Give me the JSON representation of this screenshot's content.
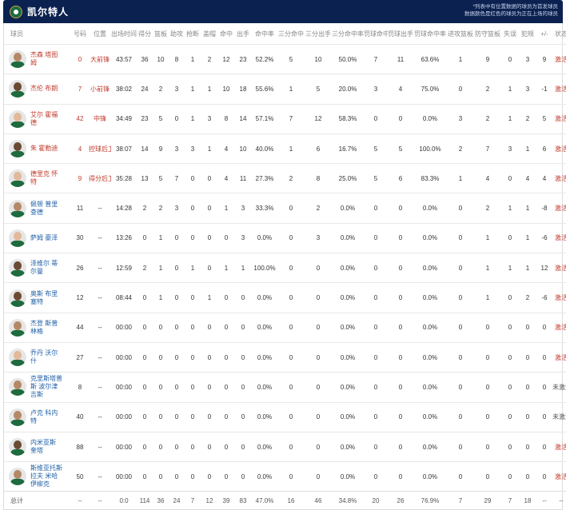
{
  "team": {
    "name": "凯尔特人",
    "note_line1": "*列表中有位置数据的球员为首发球员",
    "note_line2": "数据颜色是红色的球员为正在上场的球员"
  },
  "columns": [
    "球员",
    "号码",
    "位置",
    "出场时间",
    "得分",
    "篮板",
    "助攻",
    "抢断",
    "盖帽",
    "命中",
    "出手",
    "命中率",
    "三分命中",
    "三分出手",
    "三分命中率",
    "罚球命中",
    "罚球出手",
    "罚球命中率",
    "进攻篮板",
    "防守篮板",
    "失误",
    "犯规",
    "+/-",
    "状态"
  ],
  "players": [
    {
      "name": "杰森 塔图姆",
      "number": "0",
      "position": "大前锋",
      "min": "43:57",
      "pts": "36",
      "reb": "10",
      "ast": "8",
      "stl": "1",
      "blk": "2",
      "fgm": "12",
      "fga": "23",
      "fgp": "52.2%",
      "tpm": "5",
      "tpa": "10",
      "tpp": "50.0%",
      "ftm": "7",
      "fta": "11",
      "ftp": "63.6%",
      "oreb": "1",
      "dreb": "9",
      "tov": "0",
      "pf": "3",
      "pm": "9",
      "status": "激活",
      "starter": true
    },
    {
      "name": "杰伦 布朗",
      "number": "7",
      "position": "小前锋",
      "min": "38:02",
      "pts": "24",
      "reb": "2",
      "ast": "3",
      "stl": "1",
      "blk": "1",
      "fgm": "10",
      "fga": "18",
      "fgp": "55.6%",
      "tpm": "1",
      "tpa": "5",
      "tpp": "20.0%",
      "ftm": "3",
      "fta": "4",
      "ftp": "75.0%",
      "oreb": "0",
      "dreb": "2",
      "tov": "1",
      "pf": "3",
      "pm": "-1",
      "status": "激活",
      "starter": true
    },
    {
      "name": "艾尔 霍福德",
      "number": "42",
      "position": "中锋",
      "min": "34:49",
      "pts": "23",
      "reb": "5",
      "ast": "0",
      "stl": "1",
      "blk": "3",
      "fgm": "8",
      "fga": "14",
      "fgp": "57.1%",
      "tpm": "7",
      "tpa": "12",
      "tpp": "58.3%",
      "ftm": "0",
      "fta": "0",
      "ftp": "0.0%",
      "oreb": "3",
      "dreb": "2",
      "tov": "1",
      "pf": "2",
      "pm": "5",
      "status": "激活",
      "starter": true
    },
    {
      "name": "朱 霍勒迪",
      "number": "4",
      "position": "控球后卫",
      "min": "38:07",
      "pts": "14",
      "reb": "9",
      "ast": "3",
      "stl": "3",
      "blk": "1",
      "fgm": "4",
      "fga": "10",
      "fgp": "40.0%",
      "tpm": "1",
      "tpa": "6",
      "tpp": "16.7%",
      "ftm": "5",
      "fta": "5",
      "ftp": "100.0%",
      "oreb": "2",
      "dreb": "7",
      "tov": "3",
      "pf": "1",
      "pm": "6",
      "status": "激活",
      "starter": true
    },
    {
      "name": "德里克 怀特",
      "number": "9",
      "position": "得分后卫",
      "min": "35:28",
      "pts": "13",
      "reb": "5",
      "ast": "7",
      "stl": "0",
      "blk": "0",
      "fgm": "4",
      "fga": "11",
      "fgp": "27.3%",
      "tpm": "2",
      "tpa": "8",
      "tpp": "25.0%",
      "ftm": "5",
      "fta": "6",
      "ftp": "83.3%",
      "oreb": "1",
      "dreb": "4",
      "tov": "0",
      "pf": "4",
      "pm": "4",
      "status": "激活",
      "starter": true
    },
    {
      "name": "佩顿 普里查德",
      "number": "11",
      "position": "--",
      "min": "14:28",
      "pts": "2",
      "reb": "2",
      "ast": "3",
      "stl": "0",
      "blk": "0",
      "fgm": "1",
      "fga": "3",
      "fgp": "33.3%",
      "tpm": "0",
      "tpa": "2",
      "tpp": "0.0%",
      "ftm": "0",
      "fta": "0",
      "ftp": "0.0%",
      "oreb": "0",
      "dreb": "2",
      "tov": "1",
      "pf": "1",
      "pm": "-8",
      "status": "激活",
      "starter": false
    },
    {
      "name": "萨姆 豪泽",
      "number": "30",
      "position": "--",
      "min": "13:26",
      "pts": "0",
      "reb": "1",
      "ast": "0",
      "stl": "0",
      "blk": "0",
      "fgm": "0",
      "fga": "3",
      "fgp": "0.0%",
      "tpm": "0",
      "tpa": "3",
      "tpp": "0.0%",
      "ftm": "0",
      "fta": "0",
      "ftp": "0.0%",
      "oreb": "0",
      "dreb": "1",
      "tov": "0",
      "pf": "1",
      "pm": "-6",
      "status": "激活",
      "starter": false
    },
    {
      "name": "泽维尔 蒂尔曼",
      "number": "26",
      "position": "--",
      "min": "12:59",
      "pts": "2",
      "reb": "1",
      "ast": "0",
      "stl": "1",
      "blk": "0",
      "fgm": "1",
      "fga": "1",
      "fgp": "100.0%",
      "tpm": "0",
      "tpa": "0",
      "tpp": "0.0%",
      "ftm": "0",
      "fta": "0",
      "ftp": "0.0%",
      "oreb": "0",
      "dreb": "1",
      "tov": "1",
      "pf": "1",
      "pm": "12",
      "status": "激活",
      "starter": false
    },
    {
      "name": "奥斯 布里塞特",
      "number": "12",
      "position": "--",
      "min": "08:44",
      "pts": "0",
      "reb": "1",
      "ast": "0",
      "stl": "0",
      "blk": "1",
      "fgm": "0",
      "fga": "0",
      "fgp": "0.0%",
      "tpm": "0",
      "tpa": "0",
      "tpp": "0.0%",
      "ftm": "0",
      "fta": "0",
      "ftp": "0.0%",
      "oreb": "0",
      "dreb": "1",
      "tov": "0",
      "pf": "2",
      "pm": "-6",
      "status": "激活",
      "starter": false
    },
    {
      "name": "杰登 斯普林格",
      "number": "44",
      "position": "--",
      "min": "00:00",
      "pts": "0",
      "reb": "0",
      "ast": "0",
      "stl": "0",
      "blk": "0",
      "fgm": "0",
      "fga": "0",
      "fgp": "0.0%",
      "tpm": "0",
      "tpa": "0",
      "tpp": "0.0%",
      "ftm": "0",
      "fta": "0",
      "ftp": "0.0%",
      "oreb": "0",
      "dreb": "0",
      "tov": "0",
      "pf": "0",
      "pm": "0",
      "status": "激活",
      "starter": false
    },
    {
      "name": "乔丹 沃尔什",
      "number": "27",
      "position": "--",
      "min": "00:00",
      "pts": "0",
      "reb": "0",
      "ast": "0",
      "stl": "0",
      "blk": "0",
      "fgm": "0",
      "fga": "0",
      "fgp": "0.0%",
      "tpm": "0",
      "tpa": "0",
      "tpp": "0.0%",
      "ftm": "0",
      "fta": "0",
      "ftp": "0.0%",
      "oreb": "0",
      "dreb": "0",
      "tov": "0",
      "pf": "0",
      "pm": "0",
      "status": "激活",
      "starter": false
    },
    {
      "name": "克里斯塔普斯 波尔津吉斯",
      "number": "8",
      "position": "--",
      "min": "00:00",
      "pts": "0",
      "reb": "0",
      "ast": "0",
      "stl": "0",
      "blk": "0",
      "fgm": "0",
      "fga": "0",
      "fgp": "0.0%",
      "tpm": "0",
      "tpa": "0",
      "tpp": "0.0%",
      "ftm": "0",
      "fta": "0",
      "ftp": "0.0%",
      "oreb": "0",
      "dreb": "0",
      "tov": "0",
      "pf": "0",
      "pm": "0",
      "status": "未激活",
      "starter": false
    },
    {
      "name": "卢克 科内特",
      "number": "40",
      "position": "--",
      "min": "00:00",
      "pts": "0",
      "reb": "0",
      "ast": "0",
      "stl": "0",
      "blk": "0",
      "fgm": "0",
      "fga": "0",
      "fgp": "0.0%",
      "tpm": "0",
      "tpa": "0",
      "tpp": "0.0%",
      "ftm": "0",
      "fta": "0",
      "ftp": "0.0%",
      "oreb": "0",
      "dreb": "0",
      "tov": "0",
      "pf": "0",
      "pm": "0",
      "status": "未激活",
      "starter": false
    },
    {
      "name": "内米亚斯 奎塔",
      "number": "88",
      "position": "--",
      "min": "00:00",
      "pts": "0",
      "reb": "0",
      "ast": "0",
      "stl": "0",
      "blk": "0",
      "fgm": "0",
      "fga": "0",
      "fgp": "0.0%",
      "tpm": "0",
      "tpa": "0",
      "tpp": "0.0%",
      "ftm": "0",
      "fta": "0",
      "ftp": "0.0%",
      "oreb": "0",
      "dreb": "0",
      "tov": "0",
      "pf": "0",
      "pm": "0",
      "status": "激活",
      "starter": false
    },
    {
      "name": "斯维亚托斯拉夫 米哈伊柳克",
      "number": "50",
      "position": "--",
      "min": "00:00",
      "pts": "0",
      "reb": "0",
      "ast": "0",
      "stl": "0",
      "blk": "0",
      "fgm": "0",
      "fga": "0",
      "fgp": "0.0%",
      "tpm": "0",
      "tpa": "0",
      "tpp": "0.0%",
      "ftm": "0",
      "fta": "0",
      "ftp": "0.0%",
      "oreb": "0",
      "dreb": "0",
      "tov": "0",
      "pf": "0",
      "pm": "0",
      "status": "激活",
      "starter": false
    }
  ],
  "totals": {
    "label": "总计",
    "number": "--",
    "position": "--",
    "min": "0:0",
    "pts": "114",
    "reb": "36",
    "ast": "24",
    "stl": "7",
    "blk": "12",
    "fgm": "39",
    "fga": "83",
    "fgp": "47.0%",
    "tpm": "16",
    "tpa": "46",
    "tpp": "34.8%",
    "ftm": "20",
    "fta": "26",
    "ftp": "76.9%",
    "oreb": "7",
    "dreb": "29",
    "tov": "7",
    "pf": "18",
    "pm": "--",
    "status": "--"
  }
}
